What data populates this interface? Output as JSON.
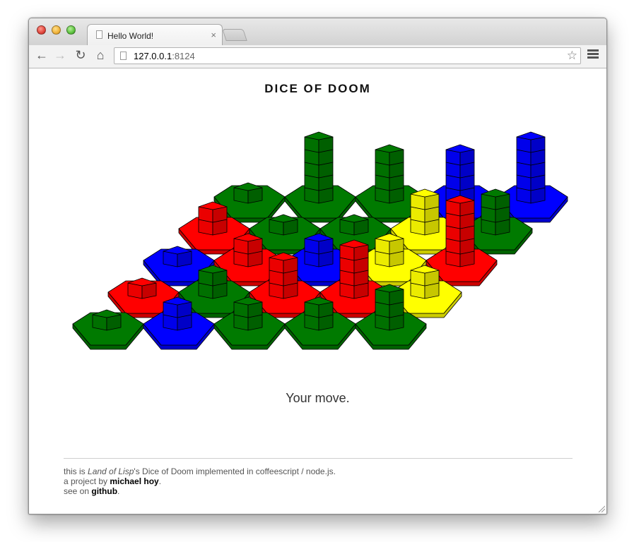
{
  "browser": {
    "tab_title": "Hello World!",
    "tab_close": "×",
    "url_host": "127.0.0.1",
    "url_port": ":8124",
    "back_icon": "←",
    "forward_icon": "→",
    "reload_icon": "↻",
    "home_icon": "⌂",
    "star_icon": "☆"
  },
  "page": {
    "title": "DICE OF DOOM",
    "status": "Your move."
  },
  "footer": {
    "line1_pre": "this is ",
    "line1_em": "Land of Lisp",
    "line1_post": "'s Dice of Doom implemented in coffeescript / node.js.",
    "line2_pre": "a project by ",
    "line2_link": "michael hoy",
    "line2_post": ".",
    "line3_pre": "see on ",
    "line3_link": "github",
    "line3_post": "."
  },
  "colors": {
    "green": "#007a00",
    "red": "#ff0000",
    "blue": "#0000ff",
    "yellow": "#ffff00"
  },
  "board": {
    "rows": [
      [
        {
          "c": "green",
          "d": 1
        },
        {
          "c": "green",
          "d": 5
        },
        {
          "c": "green",
          "d": 4
        },
        {
          "c": "blue",
          "d": 4
        },
        {
          "c": "blue",
          "d": 5
        }
      ],
      [
        {
          "c": "red",
          "d": 2
        },
        {
          "c": "green",
          "d": 1
        },
        {
          "c": "green",
          "d": 1
        },
        {
          "c": "yellow",
          "d": 3
        },
        {
          "c": "green",
          "d": 3
        }
      ],
      [
        {
          "c": "blue",
          "d": 1
        },
        {
          "c": "red",
          "d": 2
        },
        {
          "c": "blue",
          "d": 2
        },
        {
          "c": "yellow",
          "d": 2
        },
        {
          "c": "red",
          "d": 5
        }
      ],
      [
        {
          "c": "red",
          "d": 1
        },
        {
          "c": "green",
          "d": 2
        },
        {
          "c": "red",
          "d": 3
        },
        {
          "c": "red",
          "d": 4
        },
        {
          "c": "yellow",
          "d": 2
        }
      ],
      [
        {
          "c": "green",
          "d": 1
        },
        {
          "c": "blue",
          "d": 2
        },
        {
          "c": "green",
          "d": 2
        },
        {
          "c": "green",
          "d": 2
        },
        {
          "c": "green",
          "d": 3
        }
      ]
    ]
  }
}
